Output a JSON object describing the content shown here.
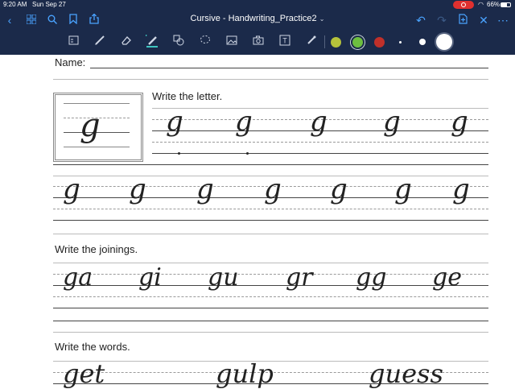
{
  "status": {
    "time": "9:20 AM",
    "date": "Sun Sep 27",
    "battery": "66%"
  },
  "nav": {
    "title": "Cursive - Handwriting_Practice2",
    "chevron": "⌄"
  },
  "colors": {
    "bar": "#1b2a4a",
    "accent": "#4aa3ff",
    "record": "#e0302f",
    "swatch_olive": "#b5c23b",
    "swatch_green": "#6dbf3f",
    "swatch_red": "#c0302a"
  },
  "worksheet": {
    "name_label": "Name:",
    "section1": "Write the letter.",
    "model_letter": "g",
    "row1_letters": [
      "g",
      "g",
      "g",
      "g",
      "g"
    ],
    "row2_letters": [
      "g",
      "g",
      "g",
      "g",
      "g",
      "g",
      "g"
    ],
    "section2": "Write the joinings.",
    "joinings": [
      "ga",
      "gi",
      "gu",
      "gr",
      "gg",
      "ge"
    ],
    "section3": "Write the words.",
    "words": [
      "get",
      "gulp",
      "guess"
    ]
  }
}
